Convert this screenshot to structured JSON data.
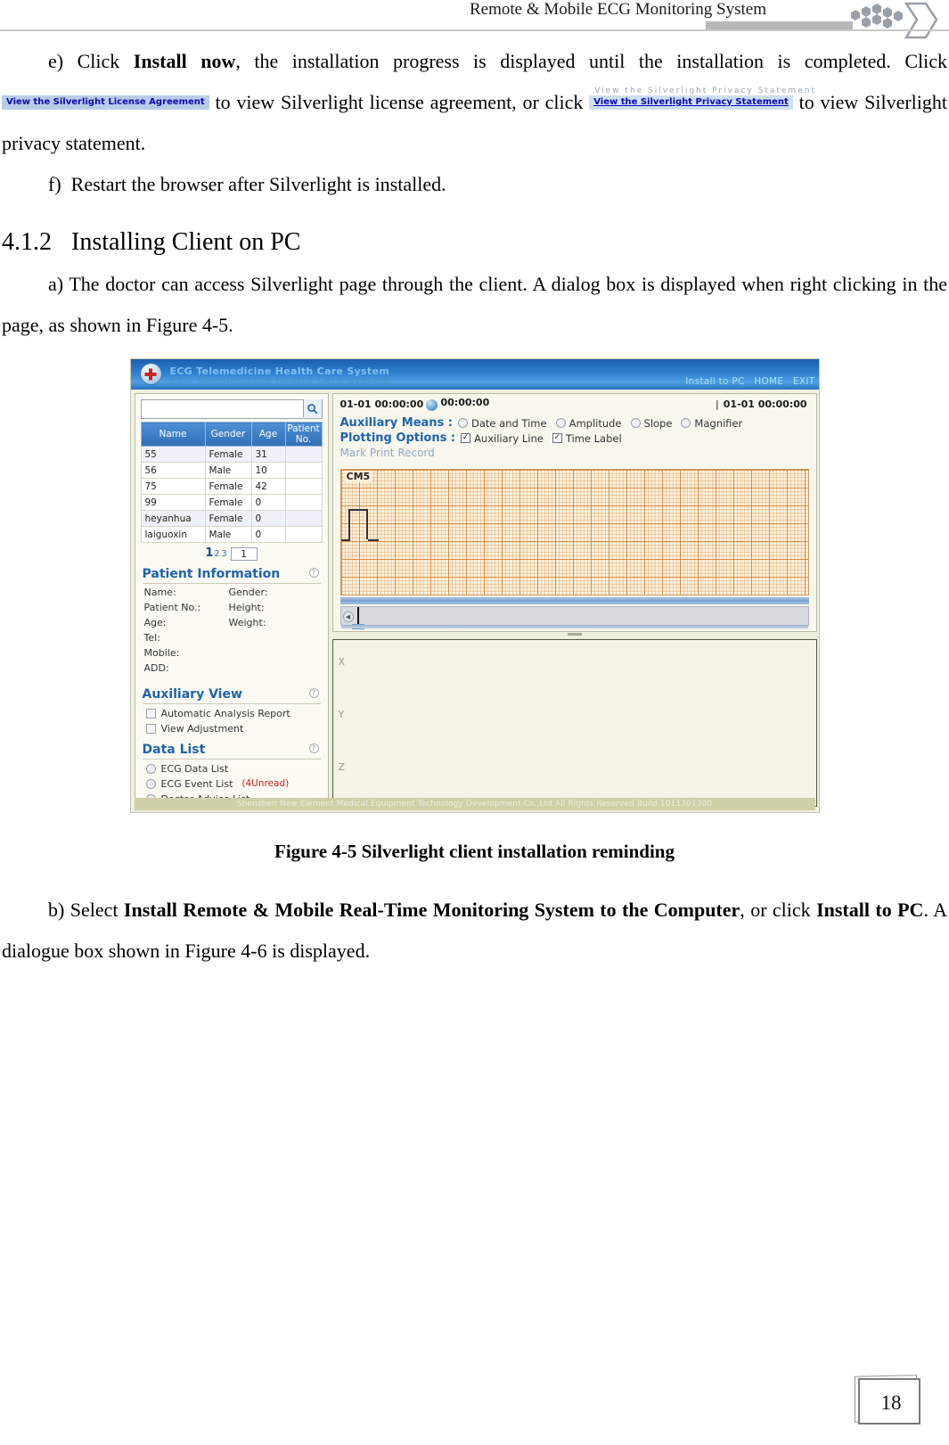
{
  "header": {
    "title": "Remote & Mobile ECG Monitoring System"
  },
  "body": {
    "para_e": {
      "marker": "e)",
      "t1": "Click",
      "bold1": "Install now",
      "t2": ", the installation progress is displayed until the installation is completed. Click",
      "chip1": "View the Silverlight License Agreement",
      "t3": "to view Silverlight license agreement, or click",
      "chip2": "View the Silverlight Privacy Statement",
      "chip2_ghost": "View the Silverlight Privacy Statement",
      "t4": "to view Silverlight privacy statement."
    },
    "para_f": {
      "marker": "f)",
      "text": "Restart the browser after Silverlight is installed."
    },
    "section": {
      "number": "4.1.2",
      "title": "Installing Client on PC"
    },
    "para_a": {
      "marker": "a)",
      "text": "The doctor can access Silverlight page through the client. A dialog box is displayed when right clicking in the page, as shown in Figure 4-5."
    },
    "para_b": {
      "marker": "b)",
      "t1": "Select",
      "bold1": "Install Remote & Mobile Real-Time Monitoring System to the Computer",
      "t2": ", or click",
      "bold2": "Install to PC",
      "t3": ". A dialogue box shown in Figure 4-6 is displayed."
    }
  },
  "figure": {
    "caption": "Figure 4-5 Silverlight client installation reminding",
    "app": {
      "title": "ECG Telemedicine Health Care System",
      "nav": [
        "Install to PC",
        "HOME",
        "EXIT"
      ],
      "search": {
        "value": "",
        "placeholder": ""
      },
      "patient_table": {
        "columns": [
          "Name",
          "Gender",
          "Age",
          "Patient No."
        ],
        "rows": [
          {
            "name": "55",
            "gender": "Female",
            "age": "31",
            "patient_no": ""
          },
          {
            "name": "56",
            "gender": "Male",
            "age": "10",
            "patient_no": ""
          },
          {
            "name": "75",
            "gender": "Female",
            "age": "42",
            "patient_no": ""
          },
          {
            "name": "99",
            "gender": "Female",
            "age": "0",
            "patient_no": ""
          },
          {
            "name": "heyanhua",
            "gender": "Female",
            "age": "0",
            "patient_no": ""
          },
          {
            "name": "laiguoxin",
            "gender": "Male",
            "age": "0",
            "patient_no": ""
          }
        ]
      },
      "pager": {
        "p1": "1",
        "p2": "2",
        "p3": "3",
        "input": "1"
      },
      "patient_information": {
        "heading": "Patient Information",
        "fields": [
          {
            "label": "Name:",
            "value": ""
          },
          {
            "label": "Gender:",
            "value": ""
          },
          {
            "label": "Patient No.:",
            "value": ""
          },
          {
            "label": "Height:",
            "value": ""
          },
          {
            "label": "Age:",
            "value": ""
          },
          {
            "label": "Weight:",
            "value": ""
          },
          {
            "label": "Tel:",
            "value": ""
          },
          {
            "label": "Mobile:",
            "value": ""
          },
          {
            "label": "ADD:",
            "value": ""
          }
        ]
      },
      "auxiliary_view": {
        "heading": "Auxiliary View",
        "items": [
          {
            "label": "Automatic Analysis Report",
            "checked": false
          },
          {
            "label": "View Adjustment",
            "checked": false
          }
        ]
      },
      "data_list": {
        "heading": "Data List",
        "items": [
          {
            "label": "ECG Data List",
            "badge": ""
          },
          {
            "label": "ECG Event List",
            "badge": "(4Unread)"
          },
          {
            "label": "Doctor Advice List",
            "badge": ""
          }
        ]
      },
      "ecg": {
        "time_left": "01-01 00:00:00",
        "time_elapsed": "00:00:00",
        "time_right": "01-01 00:00:00",
        "auxiliary_means": {
          "label": "Auxiliary Means :",
          "options": [
            "Date and Time",
            "Amplitude",
            "Slope",
            "Magnifier"
          ]
        },
        "plotting_options": {
          "label": "Plotting Options :",
          "options": [
            {
              "label": "Auxiliary Line",
              "checked": true
            },
            {
              "label": "Time Label",
              "checked": true
            }
          ]
        },
        "mark_print_record": "Mark Print Record",
        "lead_label": "CM5"
      },
      "xyz": {
        "labels": [
          "X",
          "Y",
          "Z"
        ]
      },
      "footer": "Shenzhen New Element Medical Equipment Technology Development Co.,Ltd.All Rights Reserved Build 1011301300"
    }
  },
  "page": {
    "number": "18"
  },
  "colors": {
    "accent_blue": "#1f63ad",
    "title_bar_blue": "#2f7fd0",
    "link_cyan": "#a8e0ff",
    "unread_red": "#cc2020",
    "ecg_grid_orange": "#c86e23",
    "footer_olive": "#cfd0a8"
  }
}
